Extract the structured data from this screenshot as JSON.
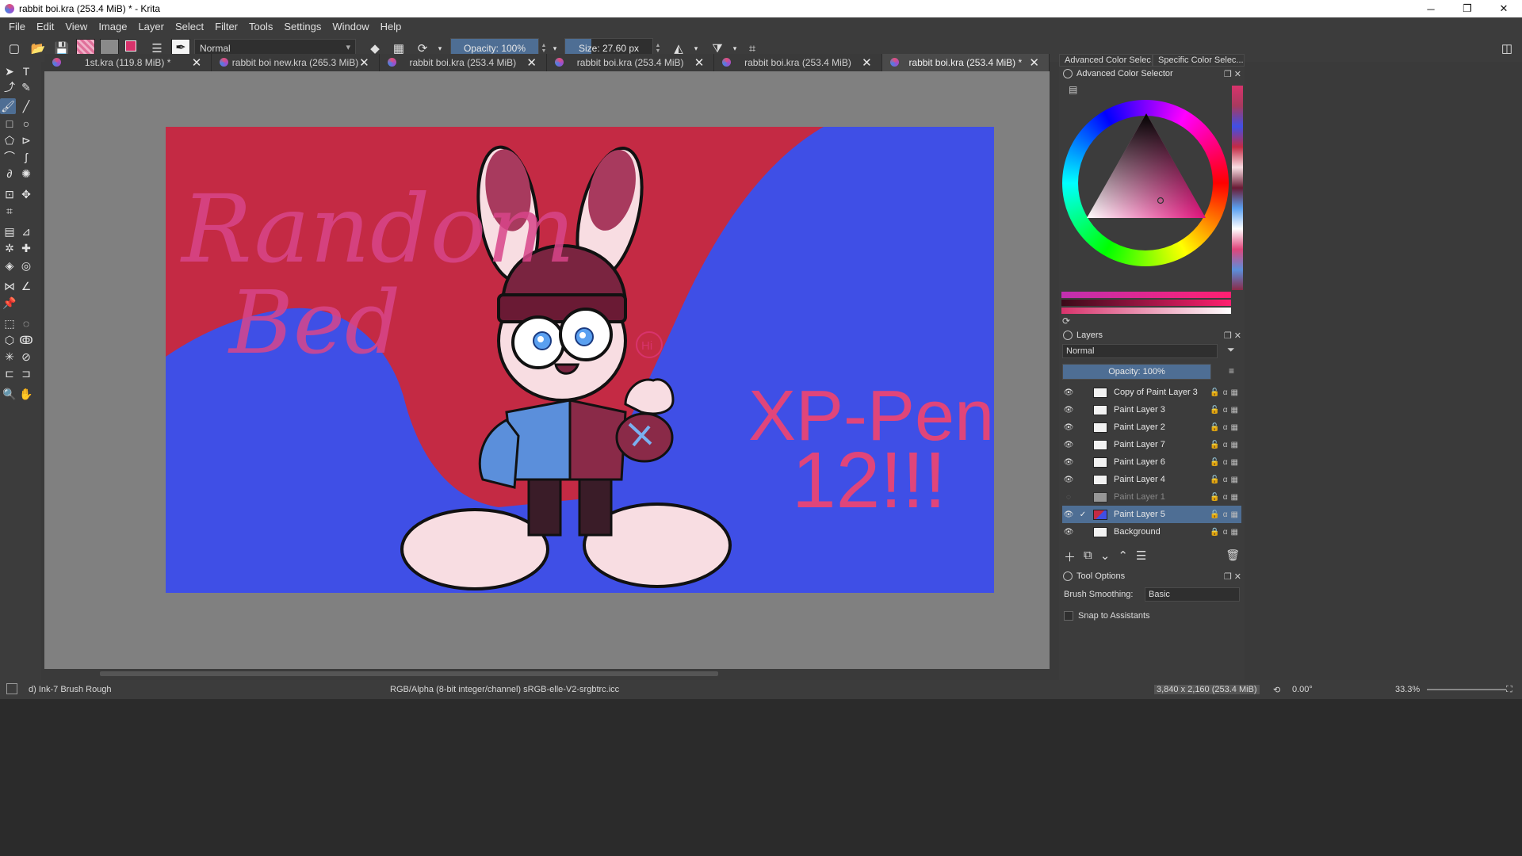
{
  "window": {
    "title": "rabbit boi.kra (253.4 MiB) * - Krita",
    "controls": [
      "─",
      "❐",
      "✕"
    ]
  },
  "menu": [
    "File",
    "Edit",
    "View",
    "Image",
    "Layer",
    "Select",
    "Filter",
    "Tools",
    "Settings",
    "Window",
    "Help"
  ],
  "toolbar": {
    "blend_mode": "Normal",
    "opacity_label": "Opacity: 100%",
    "opacity_fraction": 1.0,
    "size_label": "Size: 27.60 px",
    "fg_color": "#d8336c",
    "bg_color": "#111111"
  },
  "tabs": [
    {
      "label": "1st.kra (119.8 MiB) *"
    },
    {
      "label": "rabbit boi new.kra (265.3 MiB)"
    },
    {
      "label": "rabbit boi.kra (253.4 MiB)"
    },
    {
      "label": "rabbit boi.kra (253.4 MiB)"
    },
    {
      "label": "rabbit boi.kra (253.4 MiB)"
    },
    {
      "label": "rabbit boi.kra (253.4 MiB) *",
      "active": true
    }
  ],
  "artwork": {
    "text_left_1": "Random",
    "text_left_2": "Bed",
    "text_right_1": "XP-Pen",
    "text_right_2": "12!!!",
    "bubble": "Hi",
    "colors": {
      "red": "#c42a44",
      "blue": "#3f4fe6",
      "ink": "#d8336c"
    }
  },
  "dock": {
    "tab_1": "Advanced Color Selec...",
    "tab_2": "Specific Color Selec...",
    "color_panel_title": "Advanced Color Selector",
    "layers_title": "Layers",
    "layers_blend": "Normal",
    "layers_opacity": "Opacity:  100%",
    "layers": [
      {
        "name": "Copy of Paint Layer 3"
      },
      {
        "name": "Paint Layer 3"
      },
      {
        "name": "Paint Layer 2"
      },
      {
        "name": "Paint Layer 7"
      },
      {
        "name": "Paint Layer 6"
      },
      {
        "name": "Paint Layer 4"
      },
      {
        "name": "Paint Layer 1",
        "hidden": true
      },
      {
        "name": "Paint Layer 5",
        "selected": true
      },
      {
        "name": "Background",
        "locked": true
      }
    ],
    "tool_options_title": "Tool Options",
    "brush_smoothing_label": "Brush Smoothing:",
    "brush_smoothing_value": "Basic",
    "snap_label": "Snap to Assistants"
  },
  "status": {
    "brush": "d) Ink-7 Brush Rough",
    "color_profile": "RGB/Alpha (8-bit integer/channel)  sRGB-elle-V2-srgbtrc.icc",
    "image_size": "3,840 x 2,160 (253.4 MiB)",
    "rotation": "0.00°",
    "zoom": "33.3%"
  }
}
